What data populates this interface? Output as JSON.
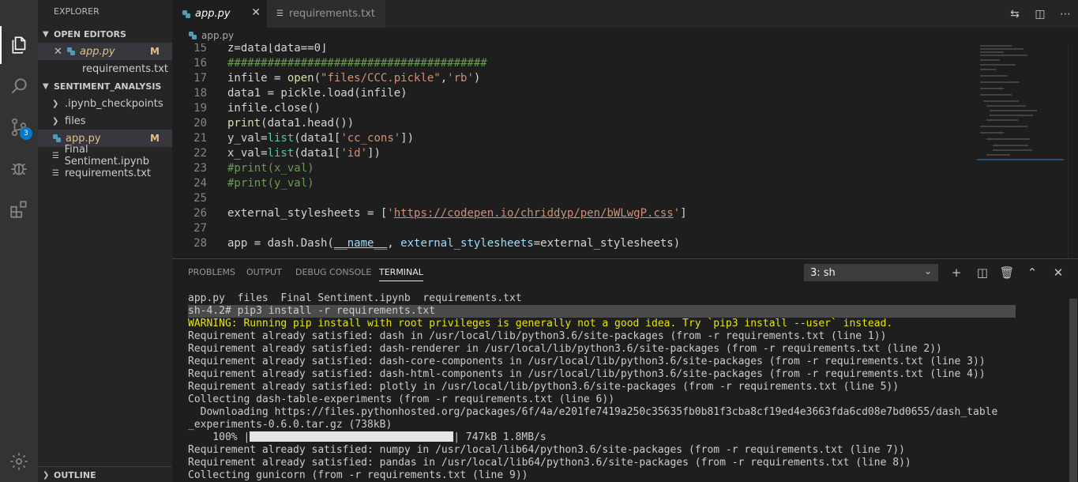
{
  "activity_bar": {
    "items": [
      "explorer-icon",
      "search-icon",
      "source-control-icon",
      "debug-icon",
      "extensions-icon"
    ],
    "source_control_badge": "3",
    "bottom": "gear-icon"
  },
  "sidebar": {
    "title": "EXPLORER",
    "open_editors": {
      "title": "OPEN EDITORS",
      "items": [
        {
          "label": "app.py",
          "modified": "M"
        },
        {
          "label": "requirements.txt"
        }
      ]
    },
    "project": {
      "title": "SENTIMENT_ANALYSIS",
      "items": [
        {
          "label": ".ipynb_checkpoints"
        },
        {
          "label": "files"
        },
        {
          "label": "app.py",
          "modified": "M"
        },
        {
          "label": "Final Sentiment.ipynb"
        },
        {
          "label": "requirements.txt"
        }
      ]
    },
    "outline": "OUTLINE"
  },
  "tabs": [
    {
      "label": "app.py"
    },
    {
      "label": "requirements.txt"
    }
  ],
  "breadcrumb": "app.py",
  "code": {
    "line_numbers": [
      "15",
      "16",
      "17",
      "18",
      "19",
      "20",
      "21",
      "22",
      "23",
      "24",
      "25",
      "26",
      "27",
      "28"
    ],
    "l15": "z=data[data==0]",
    "l16": "#######################################",
    "l17a": "infile = ",
    "l17b": "open",
    "l17c": "(",
    "l17d": "\"files/CCC.pickle\"",
    "l17e": ",",
    "l17f": "'rb'",
    "l17g": ")",
    "l18": "data1 = pickle.load(infile)",
    "l19": "infile.close()",
    "l20a": "print",
    "l20b": "(data1.head())",
    "l21a": "y_val=",
    "l21b": "list",
    "l21c": "(data1[",
    "l21d": "'cc_cons'",
    "l21e": "])",
    "l22a": "x_val=",
    "l22b": "list",
    "l22c": "(data1[",
    "l22d": "'id'",
    "l22e": "])",
    "l23": "#print(x_val)",
    "l24": "#print(y_val)",
    "l26a": "external_stylesheets = [",
    "l26b": "'",
    "l26c": "https://codepen.io/chriddyp/pen/bWLwgP.css",
    "l26d": "'",
    "l26e": "]",
    "l28a": "app = dash.Dash(",
    "l28b": "__name__",
    "l28c": ", ",
    "l28d": "external_stylesheets",
    "l28e": "=external_stylesheets)"
  },
  "panel": {
    "tabs": [
      "PROBLEMS",
      "OUTPUT",
      "DEBUG CONSOLE",
      "TERMINAL"
    ],
    "terminal_select": "3: sh"
  },
  "terminal": {
    "lines": [
      "app.py  files  Final Sentiment.ipynb  requirements.txt",
      "sh-4.2# pip3 install -r requirements.txt",
      "WARNING: Running pip install with root privileges is generally not a good idea. Try `pip3 install --user` instead.",
      "Requirement already satisfied: dash in /usr/local/lib/python3.6/site-packages (from -r requirements.txt (line 1))",
      "Requirement already satisfied: dash-renderer in /usr/local/lib/python3.6/site-packages (from -r requirements.txt (line 2))",
      "Requirement already satisfied: dash-core-components in /usr/local/lib/python3.6/site-packages (from -r requirements.txt (line 3))",
      "Requirement already satisfied: dash-html-components in /usr/local/lib/python3.6/site-packages (from -r requirements.txt (line 4))",
      "Requirement already satisfied: plotly in /usr/local/lib/python3.6/site-packages (from -r requirements.txt (line 5))",
      "Collecting dash-table-experiments (from -r requirements.txt (line 6))",
      "  Downloading https://files.pythonhosted.org/packages/6f/4a/e201fe7419a250c35635fb0b81f3cba8cf19ed4e3663fda6cd08e7bd0655/dash_table",
      "_experiments-0.6.0.tar.gz (738kB)",
      "Requirement already satisfied: numpy in /usr/local/lib64/python3.6/site-packages (from -r requirements.txt (line 7))",
      "Requirement already satisfied: pandas in /usr/local/lib64/python3.6/site-packages (from -r requirements.txt (line 8))",
      "Collecting gunicorn (from -r requirements.txt (line 9))"
    ],
    "progress_prefix": "    100% |",
    "progress_suffix": "| 747kB 1.8MB/s",
    "progress_fraction": 1.0
  }
}
